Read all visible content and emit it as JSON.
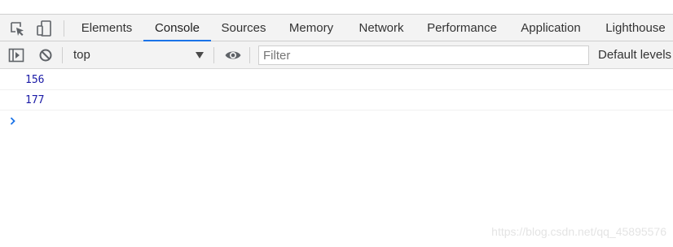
{
  "tabs": [
    {
      "label": "Elements"
    },
    {
      "label": "Console",
      "active": true
    },
    {
      "label": "Sources"
    },
    {
      "label": "Memory"
    },
    {
      "label": "Network"
    },
    {
      "label": "Performance"
    },
    {
      "label": "Application"
    },
    {
      "label": "Lighthouse"
    }
  ],
  "icons": {
    "inspect": "inspect-element-icon",
    "device": "device-toolbar-icon",
    "sidebar": "console-sidebar-icon",
    "clear": "clear-console-icon",
    "eye": "live-expression-icon",
    "prompt": "prompt-chevron-icon"
  },
  "toolbar": {
    "context": "top",
    "filter_placeholder": "Filter",
    "levels": "Default levels"
  },
  "console": {
    "messages": [
      "156",
      "177"
    ]
  },
  "watermark": "https://blog.csdn.net/qq_45895576",
  "colors": {
    "accent": "#1a73e8",
    "log_number": "#1a1aa6",
    "toolbar_bg": "#f3f3f3"
  }
}
